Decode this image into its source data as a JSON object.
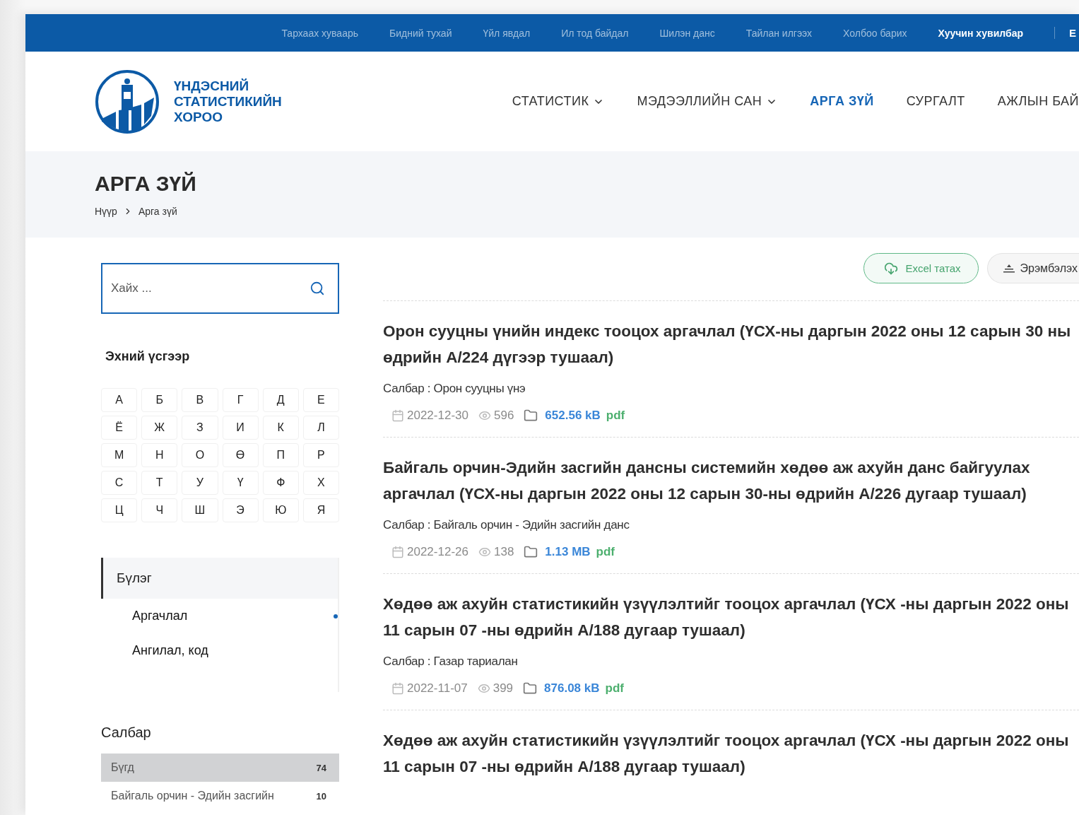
{
  "top_links": [
    {
      "label": "Тархаах хуваарь",
      "active": false
    },
    {
      "label": "Бидний тухай",
      "active": false
    },
    {
      "label": "Үйл явдал",
      "active": false
    },
    {
      "label": "Ил тод байдал",
      "active": false
    },
    {
      "label": "Шилэн данс",
      "active": false
    },
    {
      "label": "Тайлан илгээх",
      "active": false
    },
    {
      "label": "Холбоо барих",
      "active": false
    },
    {
      "label": "Хуучин хувилбар",
      "active": true
    }
  ],
  "language": "E",
  "logo_lines": [
    "ҮНДЭСНИЙ",
    "СТАТИСТИКИЙН",
    "ХОРОО"
  ],
  "main_nav": [
    {
      "label": "СТАТИСТИК",
      "has_dropdown": true,
      "selected": false
    },
    {
      "label": "МЭДЭЭЛЛИЙН САН",
      "has_dropdown": true,
      "selected": false
    },
    {
      "label": "АРГА ЗҮЙ",
      "has_dropdown": false,
      "selected": true
    },
    {
      "label": "СУРГАЛТ",
      "has_dropdown": false,
      "selected": false
    },
    {
      "label": "АЖЛЫН БАЙ",
      "has_dropdown": false,
      "selected": false
    }
  ],
  "page_title": "АРГА ЗҮЙ",
  "breadcrumb": [
    "Нүүр",
    "Арга зүй"
  ],
  "search": {
    "placeholder": "Хайх ..."
  },
  "letters_heading": "Эхний үсгээр",
  "letters": [
    "А",
    "Б",
    "В",
    "Г",
    "Д",
    "Е",
    "Ё",
    "Ж",
    "З",
    "И",
    "К",
    "Л",
    "М",
    "Н",
    "О",
    "Ө",
    "П",
    "Р",
    "С",
    "Т",
    "У",
    "Ү",
    "Ф",
    "Х",
    "Ц",
    "Ч",
    "Ш",
    "Э",
    "Ю",
    "Я"
  ],
  "groups": {
    "title": "Бүлэг",
    "items": [
      {
        "label": "Аргачлал",
        "selected": true
      },
      {
        "label": "Ангилал, код",
        "selected": false
      }
    ]
  },
  "sectors": {
    "title": "Салбар",
    "items": [
      {
        "label": "Бүгд",
        "count": "74",
        "selected": true
      },
      {
        "label": "Байгаль орчин - Эдийн засгийн",
        "count": "10",
        "selected": false
      }
    ]
  },
  "actions": {
    "excel": "Excel татах",
    "sort": "Эрэмбэлэх"
  },
  "documents": [
    {
      "title": "Орон сууцны үнийн индекс тооцох аргачлал (ҮСХ-ны даргын 2022 оны 12 сарын 30 ны өдрийн А/224 дүгээр тушаал)",
      "sector": "Салбар : Орон сууцны үнэ",
      "date": "2022-12-30",
      "views": "596",
      "size": "652.56 kB",
      "format": "pdf"
    },
    {
      "title": "Байгаль орчин-Эдийн засгийн дансны системийн хөдөө аж ахуйн данс байгуулах аргачлал (ҮСХ-ны даргын 2022 оны 12 сарын 30-ны өдрийн А/226 дугаар тушаал)",
      "sector": "Салбар : Байгаль орчин - Эдийн засгийн данс",
      "date": "2022-12-26",
      "views": "138",
      "size": "1.13 MB",
      "format": "pdf"
    },
    {
      "title": "Хөдөө аж ахуйн статистикийн үзүүлэлтийг тооцох аргачлал (ҮСХ -ны даргын 2022 оны 11 сарын 07 -ны өдрийн А/188 дугаар тушаал)",
      "sector": "Салбар : Газар тариалан",
      "date": "2022-11-07",
      "views": "399",
      "size": "876.08 kB",
      "format": "pdf"
    },
    {
      "title": "Хөдөө аж ахуйн статистикийн үзүүлэлтийг тооцох аргачлал (ҮСХ -ны даргын 2022 оны 11 сарын 07 -ны өдрийн А/188 дугаар тушаал)"
    }
  ]
}
